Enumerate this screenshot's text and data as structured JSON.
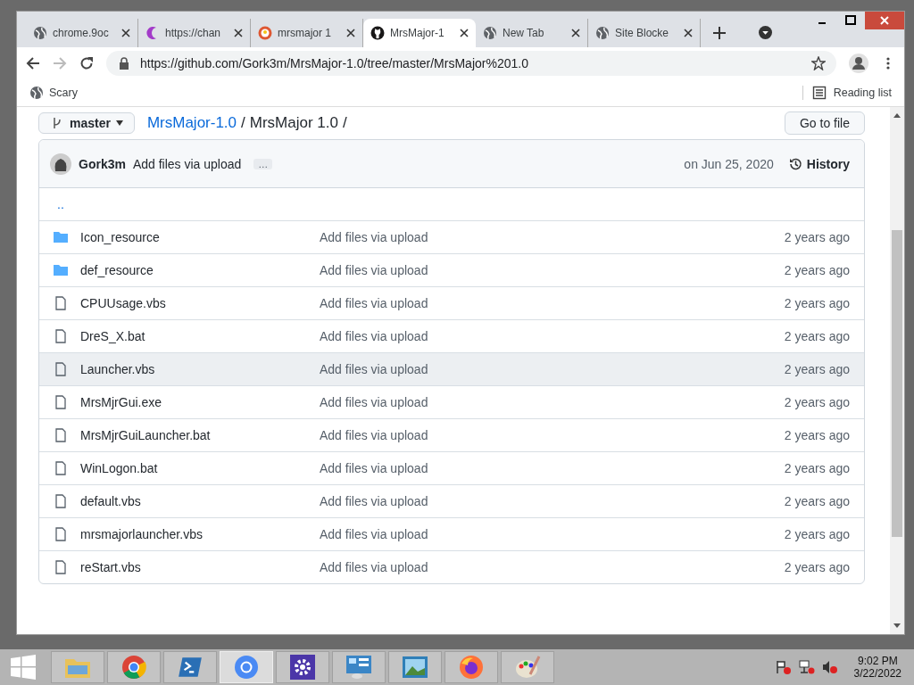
{
  "tabs": [
    {
      "title": "chrome.9oc",
      "kind": "globe",
      "selected": false
    },
    {
      "title": "https://chan",
      "kind": "crescent",
      "selected": false
    },
    {
      "title": "mrsmajor 1",
      "kind": "duck",
      "selected": false
    },
    {
      "title": "MrsMajor-1",
      "kind": "octo",
      "selected": true
    },
    {
      "title": "New Tab",
      "kind": "globe",
      "selected": false
    },
    {
      "title": "Site Blocke",
      "kind": "globe",
      "selected": false
    }
  ],
  "address": {
    "value": "https://github.com/Gork3m/MrsMajor-1.0/tree/master/MrsMajor%201.0"
  },
  "bookmarks": [
    {
      "label": "Scary"
    }
  ],
  "reading_list": "Reading list",
  "repo": {
    "branch": "master",
    "breadcrumb": [
      {
        "label": "MrsMajor-1.0",
        "kind": "link"
      },
      {
        "label": "/",
        "kind": "sep"
      },
      {
        "label": "MrsMajor 1.0",
        "kind": "current"
      },
      {
        "label": "/",
        "kind": "sep"
      }
    ],
    "go_to_file": "Go to file"
  },
  "commit": {
    "author": "Gork3m",
    "message": "Add files via upload",
    "more": "…",
    "date": "on Jun 25, 2020",
    "history": "History"
  },
  "parent_link": "..",
  "files": [
    {
      "kind": "folder",
      "name": "Icon_resource",
      "message": "Add files via upload",
      "age": "2 years ago",
      "highlighted": false
    },
    {
      "kind": "folder",
      "name": "def_resource",
      "message": "Add files via upload",
      "age": "2 years ago",
      "highlighted": false
    },
    {
      "kind": "file",
      "name": "CPUUsage.vbs",
      "message": "Add files via upload",
      "age": "2 years ago",
      "highlighted": false
    },
    {
      "kind": "file",
      "name": "DreS_X.bat",
      "message": "Add files via upload",
      "age": "2 years ago",
      "highlighted": false
    },
    {
      "kind": "file",
      "name": "Launcher.vbs",
      "message": "Add files via upload",
      "age": "2 years ago",
      "highlighted": true
    },
    {
      "kind": "file",
      "name": "MrsMjrGui.exe",
      "message": "Add files via upload",
      "age": "2 years ago",
      "highlighted": false
    },
    {
      "kind": "file",
      "name": "MrsMjrGuiLauncher.bat",
      "message": "Add files via upload",
      "age": "2 years ago",
      "highlighted": false
    },
    {
      "kind": "file",
      "name": "WinLogon.bat",
      "message": "Add files via upload",
      "age": "2 years ago",
      "highlighted": false
    },
    {
      "kind": "file",
      "name": "default.vbs",
      "message": "Add files via upload",
      "age": "2 years ago",
      "highlighted": false
    },
    {
      "kind": "file",
      "name": "mrsmajorlauncher.vbs",
      "message": "Add files via upload",
      "age": "2 years ago",
      "highlighted": false
    },
    {
      "kind": "file",
      "name": "reStart.vbs",
      "message": "Add files via upload",
      "age": "2 years ago",
      "highlighted": false
    }
  ],
  "taskbar": {
    "apps": [
      {
        "kind": "explorer",
        "selected": false
      },
      {
        "kind": "chrome",
        "selected": false
      },
      {
        "kind": "terminal",
        "selected": false
      },
      {
        "kind": "chromium",
        "selected": true
      },
      {
        "kind": "settings",
        "selected": false
      },
      {
        "kind": "control",
        "selected": false
      },
      {
        "kind": "photos",
        "selected": false
      },
      {
        "kind": "firefox",
        "selected": false
      },
      {
        "kind": "paint",
        "selected": false
      }
    ],
    "time": "9:02 PM",
    "date": "3/22/2022"
  }
}
